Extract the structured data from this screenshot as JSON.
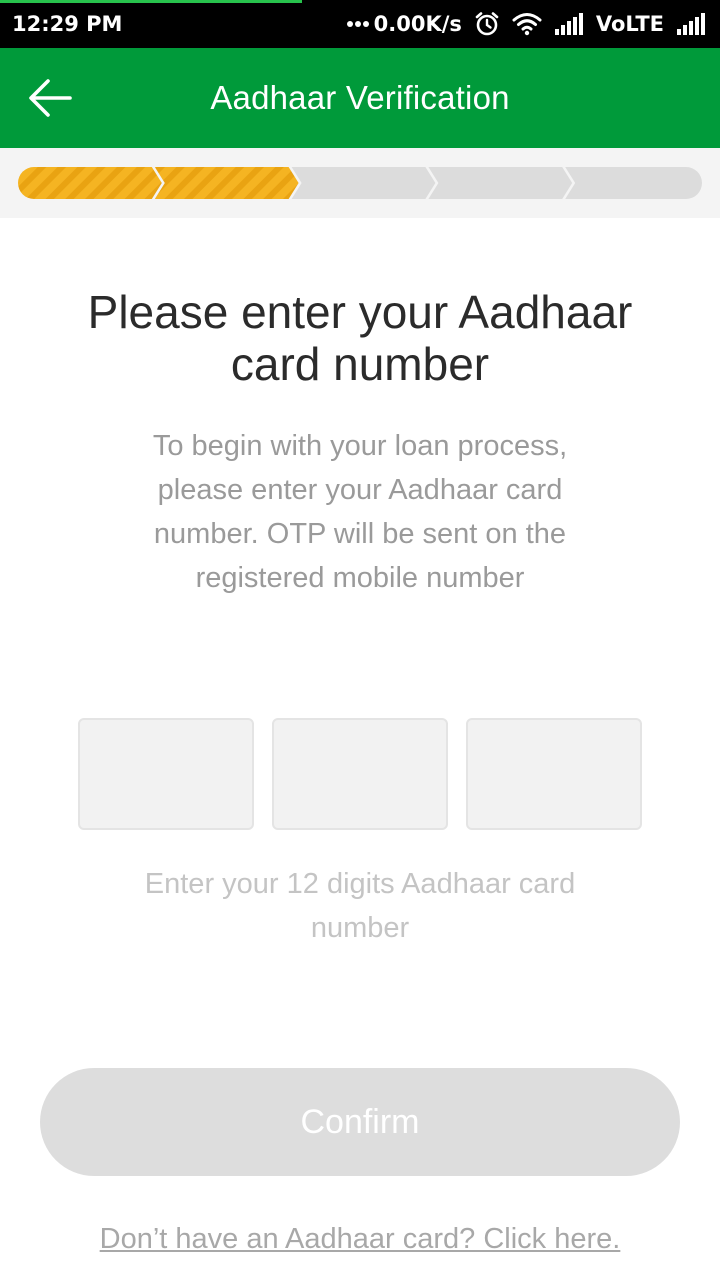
{
  "status_bar": {
    "time": "12:29 PM",
    "net_speed": "0.00K/s",
    "network": "VoLTE",
    "icons": [
      "dots-icon",
      "alarm-icon",
      "wifi-icon",
      "signal-icon",
      "signal-icon"
    ]
  },
  "app_bar": {
    "title": "Aadhaar Verification",
    "back_icon": "arrow-left-icon"
  },
  "stepper": {
    "total_steps": 5,
    "completed_steps": 2,
    "active_color": "#f5b422",
    "inactive_color": "#dcdcdc"
  },
  "content": {
    "headline": "Please enter your Aadhaar card number",
    "description": "To begin with your loan process, please enter your Aadhaar card number. OTP will be sent on the registered mobile number",
    "aadhaar_fields": [
      {
        "value": "",
        "placeholder": ""
      },
      {
        "value": "",
        "placeholder": ""
      },
      {
        "value": "",
        "placeholder": ""
      }
    ],
    "hint": "Enter your 12 digits Aadhaar card number"
  },
  "actions": {
    "confirm_label": "Confirm",
    "no_aadhaar_link": "Don’t have an Aadhaar card? Click here."
  },
  "colors": {
    "brand_green": "#009a3a",
    "button_disabled": "#dddddd"
  }
}
